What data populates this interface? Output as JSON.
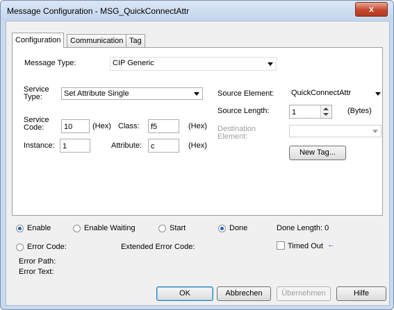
{
  "window": {
    "title": "Message Configuration - MSG_QuickConnectAttr",
    "close_glyph": "x"
  },
  "tabs": [
    {
      "label": "Configuration",
      "active": true
    },
    {
      "label": "Communication",
      "active": false
    },
    {
      "label": "Tag",
      "active": false
    }
  ],
  "config": {
    "message_type_label": "Message Type:",
    "message_type_value": "CIP Generic",
    "service_type_label_1": "Service",
    "service_type_label_2": "Type:",
    "service_type_value": "Set Attribute Single",
    "service_code_label_1": "Service",
    "service_code_label_2": "Code:",
    "service_code_value": "10",
    "service_code_unit": "(Hex)",
    "class_label": "Class:",
    "class_value": "f5",
    "class_unit": "(Hex)",
    "instance_label": "Instance:",
    "instance_value": "1",
    "attribute_label": "Attribute:",
    "attribute_value": "c",
    "attribute_unit": "(Hex)",
    "source_element_label": "Source Element:",
    "source_element_value": "QuickConnectAttr",
    "source_length_label": "Source Length:",
    "source_length_value": "1",
    "source_length_unit": "(Bytes)",
    "destination_label_1": "Destination",
    "destination_label_2": "Element:",
    "destination_value": "",
    "new_tag_label": "New Tag..."
  },
  "status": {
    "enable_label": "Enable",
    "enable_on": true,
    "enable_waiting_label": "Enable Waiting",
    "enable_waiting_on": false,
    "start_label": "Start",
    "start_on": false,
    "done_label": "Done",
    "done_on": true,
    "done_length_label": "Done Length: 0",
    "error_code_label": "Error Code:",
    "extended_error_label": "Extended Error Code:",
    "timed_out_label": "Timed Out",
    "timed_out_checked": false,
    "timed_out_arrow": "←",
    "error_path_label": "Error Path:",
    "error_text_label": "Error Text:"
  },
  "buttons": {
    "ok": "OK",
    "cancel": "Abbrechen",
    "apply": "Übernehmen",
    "help": "Hilfe"
  },
  "colors": {
    "radio_selected": "#1a5fc6",
    "close_button": "#c6472e",
    "arrow": "#1f5fd0"
  }
}
